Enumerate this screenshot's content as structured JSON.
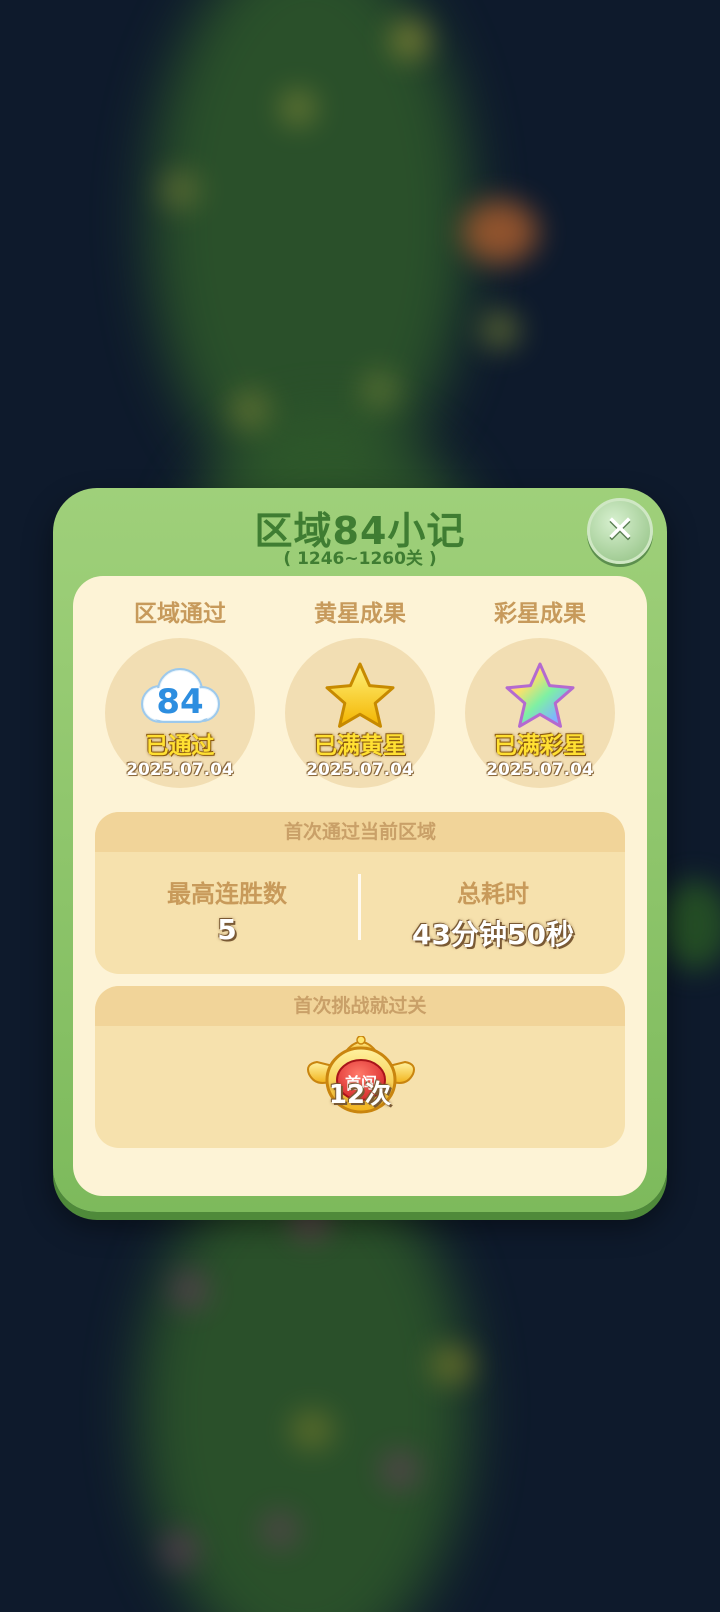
{
  "modal": {
    "title": "区域84小记",
    "subtitle": "( 1246~1260关 )",
    "close_icon": "close-icon"
  },
  "achievements": [
    {
      "label": "区域通过",
      "icon": "cloud-icon",
      "icon_number": "84",
      "status": "已通过",
      "date": "2025.07.04"
    },
    {
      "label": "黄星成果",
      "icon": "yellow-star-icon",
      "status": "已满黄星",
      "date": "2025.07.04"
    },
    {
      "label": "彩星成果",
      "icon": "rainbow-star-icon",
      "status": "已满彩星",
      "date": "2025.07.04"
    }
  ],
  "first_clear": {
    "header": "首次通过当前区域",
    "stats": [
      {
        "label": "最高连胜数",
        "value": "5"
      },
      {
        "label": "总耗时",
        "value": "43分钟50秒"
      }
    ]
  },
  "first_try": {
    "header": "首次挑战就过关",
    "badge_label": "首闯",
    "count": "12次"
  },
  "colors": {
    "frame_green": "#8fc76c",
    "title_green": "#3f7d32",
    "panel_cream": "#fdf3d6",
    "label_brown": "#c79a5b",
    "status_yellow": "#ffe032",
    "background": "#0e1a2c"
  }
}
